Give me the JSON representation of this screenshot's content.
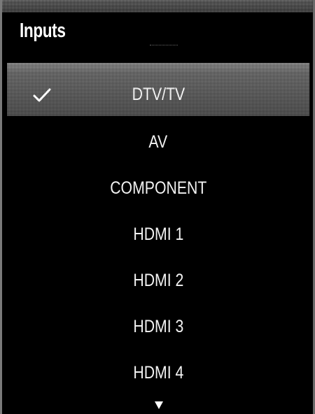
{
  "menu": {
    "title": "Inputs",
    "items": [
      {
        "label": "DTV/TV",
        "selected": true
      },
      {
        "label": "AV",
        "selected": false
      },
      {
        "label": "COMPONENT",
        "selected": false
      },
      {
        "label": "HDMI 1",
        "selected": false
      },
      {
        "label": "HDMI 2",
        "selected": false
      },
      {
        "label": "HDMI 3",
        "selected": false
      },
      {
        "label": "HDMI 4",
        "selected": false
      }
    ],
    "selected_icon": "check-icon",
    "more_indicator_icon": "scroll-down-icon"
  },
  "colors": {
    "background": "#000000",
    "text": "#f2f2f2",
    "highlight": "#8e8e8e"
  }
}
